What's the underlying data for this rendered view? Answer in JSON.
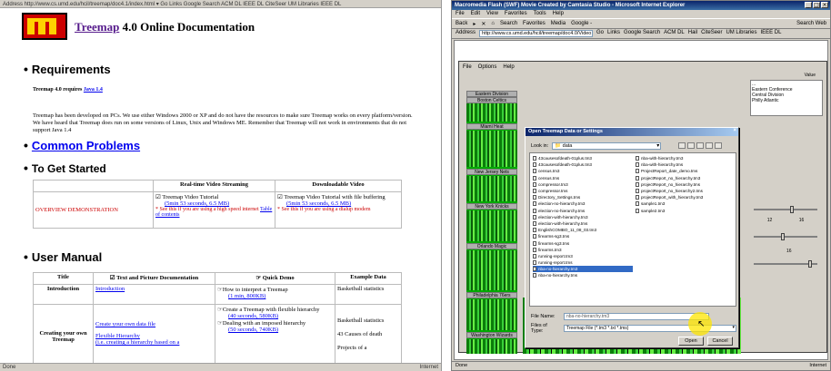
{
  "left": {
    "top_bar": "Address  http://www.cs.umd.edu/hcil/treemap/doc4.1/index.html  ▾  Go  Links  Google Search  ACM DL  IEEE DL  CiteSeer  UM Libraries  IEEE DL",
    "title_link": "Treemap",
    "title_rest": " 4.0 Online Documentation",
    "requirements_heading": "Requirements",
    "requires_text": "Treemap 4.0 requires ",
    "requires_link": "Java 1.4",
    "para": "Treemap has been developed on PCs. We use either Windows 2000 or XP and do not have the resources to make sure Treemap works on every platform/version. We have heard that Treemap does run on some versions of Linux, Unix and Windows ME. Remember that Treemap will not work in environments that do not support Java 1.4",
    "common_problems": "Common Problems",
    "get_started_heading": "To Get Started",
    "video_table": {
      "headers": [
        "",
        "Real-time Video Streaming",
        "Downloadable Video"
      ],
      "row_label": "OVERVIEW DEMONSTRATION",
      "stream_title": "Treemap Video Tutorial",
      "stream_link": "(5min 53 seconds, 6.5 MB)",
      "stream_note": "* See this if you are using a high speed internet ",
      "stream_toc": "Table of contents",
      "dl_title": "Treemap Video Tutorial with file buffering",
      "dl_link": "(5min 53 seconds, 6.5 MB)",
      "dl_note": "* See this if you are using a dialup modem"
    },
    "user_manual_heading": "User Manual",
    "manual_table": {
      "headers": [
        "Title",
        "Text and Picture Documentation",
        "Quick Demo",
        "Example Data"
      ],
      "row1": {
        "title": "Introduction",
        "doc": "Introduction",
        "demo": "How to interpret a Treemap",
        "demo_link": "(1 min, 800KB)",
        "data": "Basketball statistics"
      },
      "row2": {
        "title": "Creating your own Treemap",
        "doc1": "Create your own data file",
        "doc2": "Flexible Hierarchy",
        "doc3": "(i.e. creating a hierarchy based on a",
        "demo1": "Create a Treemap with flexible hierarchy",
        "demo1_link": "(40 seconds, 580KB)",
        "demo2": "Dealing with an imposed hierarchy",
        "demo2_link": "(50 seconds, 740KB)",
        "data1": "Basketball statistics",
        "data2": "43 Causes of death",
        "data3": "Projects of a"
      }
    },
    "status_left": "Done",
    "status_right": "Internet"
  },
  "right": {
    "window_title": "Macromedia Flash (SWF) Movie Created by Camtasia Studio - Microsoft Internet Explorer",
    "menu": [
      "File",
      "Edit",
      "View",
      "Favorites",
      "Tools",
      "Help"
    ],
    "toolbar": [
      "Back",
      "▸",
      "✕",
      "⌂",
      "Search",
      "Favorites",
      "Media",
      "Google -"
    ],
    "toolbar_right": "Search Web",
    "address_label": "Address",
    "address_value": "http://www.cs.umd.edu/hcil/treemap/doc4.0/Video",
    "address_go": "Go",
    "links": [
      "Links",
      "Google Search",
      "ACM DL",
      "Hail",
      "CiteSeer",
      "UM Libraries",
      "IEEE DL"
    ],
    "app_menu": [
      "File",
      "Options",
      "Help"
    ],
    "treemap_labels": [
      "Eastern Division",
      "Boston Celtics",
      "Miami Heat",
      "New Jersey Nets",
      "New York Knicks",
      "Orlando Magic",
      "Philadelphia 76ers",
      "Washington Wizards"
    ],
    "panel_header": "Value",
    "panel_items": [
      "...",
      "Eastern Conference",
      "Central Division",
      "Philly Atlantic"
    ],
    "slider_values": [
      "12",
      "16",
      "16"
    ],
    "dialog": {
      "title": "Open Treemap Data or Settings",
      "look_in_label": "Look in:",
      "look_in_value": "data",
      "files_col1": [
        "43causesofdeath-01plus.tm3",
        "43causesofdeath-01plus.tm3",
        "census.tm3",
        "census.tms",
        "compressor.tm3",
        "compressor.tms",
        "Directory_Settings.tms",
        "election-no-hierarchy.tm3",
        "election-no-hierarchy.tms",
        "election-with-hierarchy.tm3",
        "election-with-hierarchy.tms",
        "EnglishCOMBO_11_08_03.tm3",
        "firearms-sg3.tms",
        "firearms-sg3.tms",
        "firearms.tm3",
        "running-report.tm3",
        "running-report.tms",
        "nba-no-hierarchy.tm3",
        "nba-no-hierarchy.tms"
      ],
      "files_col2": [
        "nba-with-hierarchy.tm3",
        "nba-with-hierarchy.tms",
        "ProjectReport_date_demo.tms",
        "projectReport_no_hierarchy.tm3",
        "projectReport_no_hierarchy.tms",
        "projectReport_no_hierarchy2.tms",
        "projectReport_with_hierarchy.tm3",
        "sample1.tm3",
        "sample2.tm3"
      ],
      "selected_index": 17,
      "filename_label": "File Name:",
      "filename_value": "nba-no-hierarchy.tm3",
      "filetype_label": "Files of Type:",
      "filetype_value": "Treemap File (*.tm3 *.txt *.tms)",
      "open_button": "Open",
      "cancel_button": "Cancel"
    },
    "status_left": "Done",
    "status_right": "Internet"
  }
}
